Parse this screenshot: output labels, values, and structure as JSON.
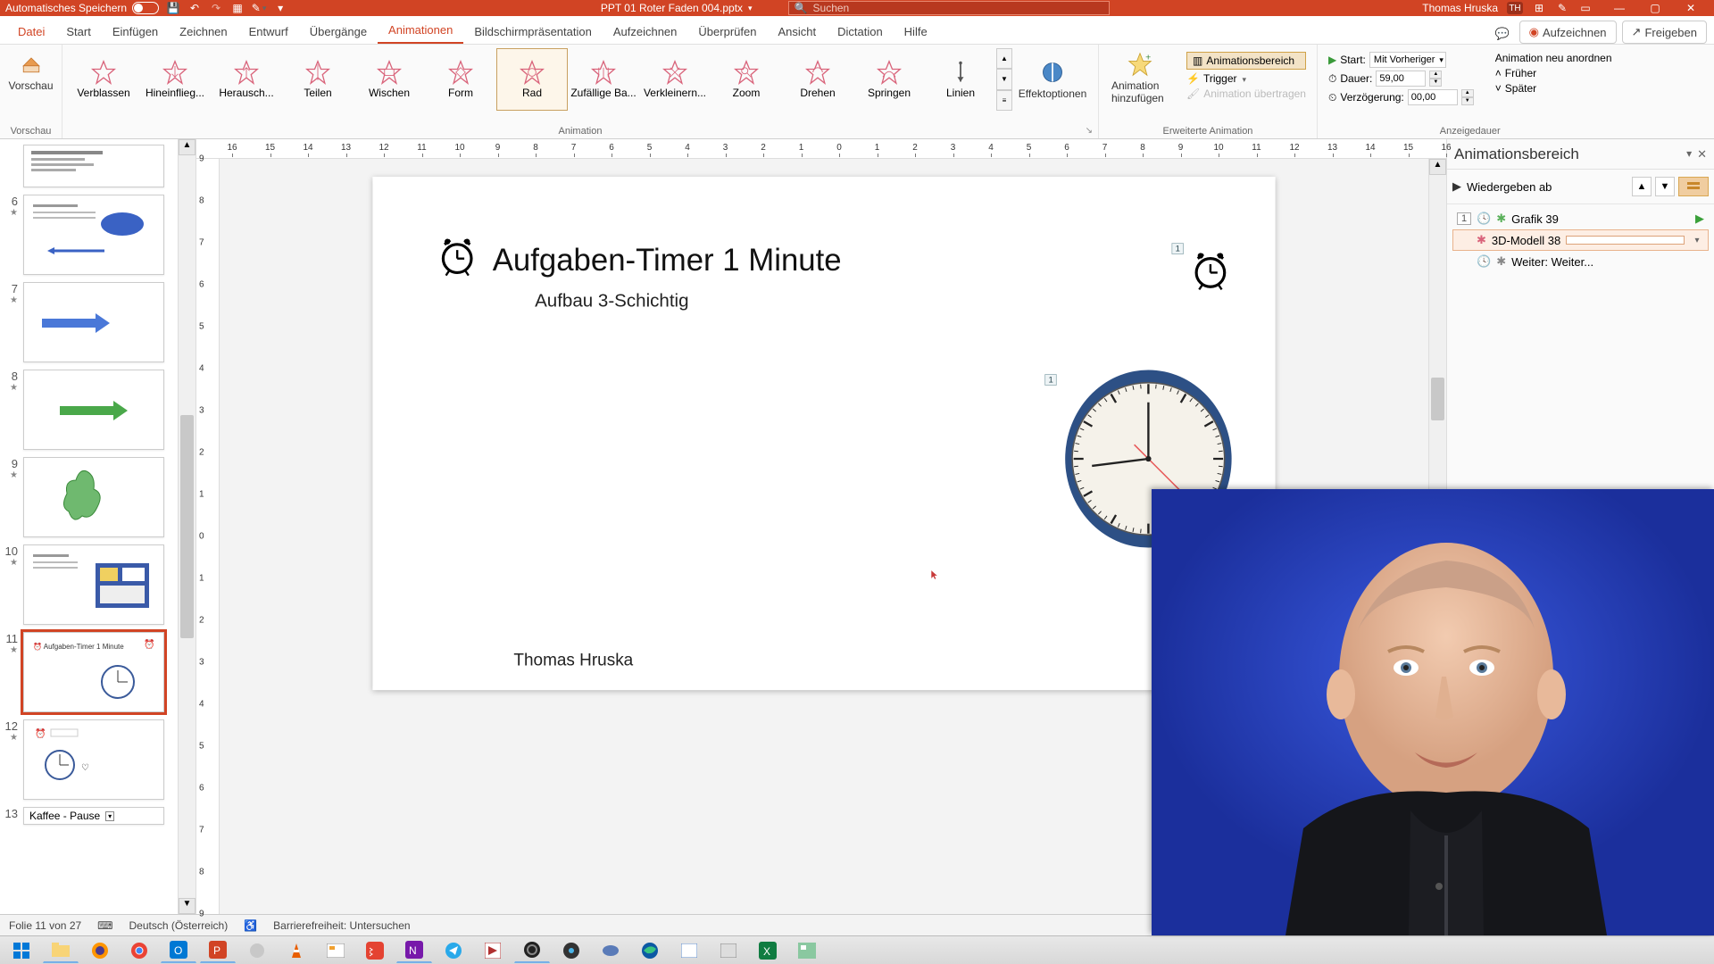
{
  "titlebar": {
    "autosave_label": "Automatisches Speichern",
    "filename": "PPT 01 Roter Faden 004.pptx",
    "search_placeholder": "Suchen",
    "user_name": "Thomas Hruska",
    "user_initials": "TH"
  },
  "tabs": {
    "file": "Datei",
    "list": [
      "Start",
      "Einfügen",
      "Zeichnen",
      "Entwurf",
      "Übergänge",
      "Animationen",
      "Bildschirmpräsentation",
      "Aufzeichnen",
      "Überprüfen",
      "Ansicht",
      "Dictation",
      "Hilfe"
    ],
    "active": "Animationen",
    "record": "Aufzeichnen",
    "share": "Freigeben"
  },
  "ribbon": {
    "preview": "Vorschau",
    "group_anim": "Animation",
    "effects": [
      "Verblassen",
      "Hineinflieg...",
      "Herausch...",
      "Teilen",
      "Wischen",
      "Form",
      "Rad",
      "Zufällige Ba...",
      "Verkleinern...",
      "Zoom",
      "Drehen",
      "Springen",
      "Linien"
    ],
    "selected_effect": "Rad",
    "effect_options": "Effektoptionen",
    "add_animation": "Animation hinzufügen",
    "anim_pane_btn": "Animationsbereich",
    "trigger": "Trigger",
    "anim_painter": "Animation übertragen",
    "group_adv": "Erweiterte Animation",
    "start_label": "Start:",
    "start_value": "Mit Vorheriger",
    "duration_label": "Dauer:",
    "duration_value": "59,00",
    "delay_label": "Verzögerung:",
    "delay_value": "00,00",
    "reorder_label": "Animation neu anordnen",
    "earlier": "Früher",
    "later": "Später",
    "group_timing": "Anzeigedauer"
  },
  "ruler_marks": [
    "16",
    "15",
    "14",
    "13",
    "12",
    "11",
    "10",
    "9",
    "8",
    "7",
    "6",
    "5",
    "4",
    "3",
    "2",
    "1",
    "0",
    "1",
    "2",
    "3",
    "4",
    "5",
    "6",
    "7",
    "8",
    "9",
    "10",
    "11",
    "12",
    "13",
    "14",
    "15",
    "16"
  ],
  "ruler_v_marks": [
    "9",
    "8",
    "7",
    "6",
    "5",
    "4",
    "3",
    "2",
    "1",
    "0",
    "1",
    "2",
    "3",
    "4",
    "5",
    "6",
    "7",
    "8",
    "9"
  ],
  "thumbs": [
    {
      "num": "6"
    },
    {
      "num": "7"
    },
    {
      "num": "8"
    },
    {
      "num": "9"
    },
    {
      "num": "10"
    },
    {
      "num": "11",
      "active": true
    },
    {
      "num": "12"
    },
    {
      "num": "13",
      "label": "Kaffee - Pause"
    }
  ],
  "slide": {
    "title": "Aufgaben-Timer 1 Minute",
    "subtitle": "Aufbau 3-Schichtig",
    "author": "Thomas Hruska",
    "tag1": "1",
    "tag2": "1"
  },
  "anim_pane": {
    "title": "Animationsbereich",
    "play": "Wiedergeben ab",
    "ord": "1",
    "item1": "Grafik 39",
    "item2": "3D-Modell 38",
    "item3": "Weiter: Weiter..."
  },
  "status": {
    "slide_of": "Folie 11 von 27",
    "language": "Deutsch (Österreich)",
    "a11y": "Barrierefreiheit: Untersuchen"
  }
}
